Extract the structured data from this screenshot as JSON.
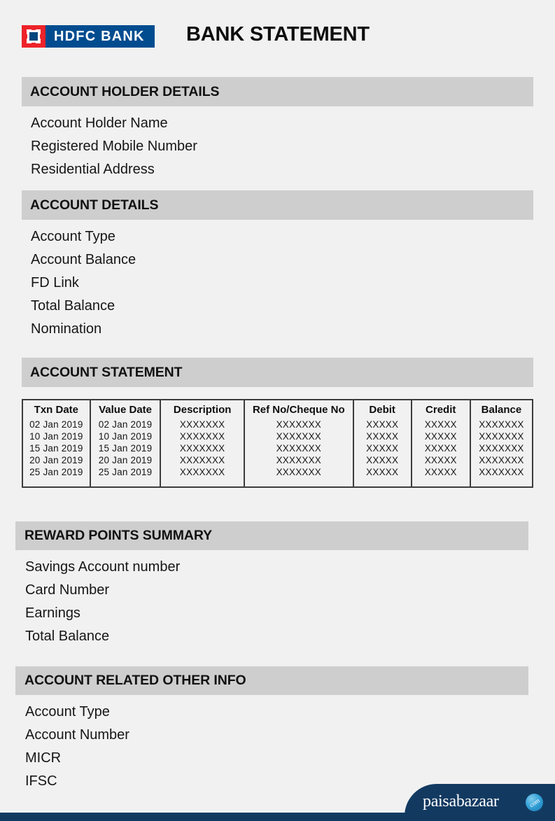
{
  "header": {
    "logo_text": "HDFC BANK",
    "title": "BANK STATEMENT",
    "logo_red": "#ed232a",
    "logo_blue": "#004c8f"
  },
  "sections": [
    {
      "title": "ACCOUNT HOLDER DETAILS",
      "lines": [
        "Account Holder Name",
        "Registered Mobile Number",
        "Residential Address"
      ]
    },
    {
      "title": "ACCOUNT DETAILS",
      "lines": [
        "Account Type",
        "Account Balance",
        "FD Link",
        "Total Balance",
        "Nomination"
      ]
    },
    {
      "title": "ACCOUNT STATEMENT",
      "lines": []
    },
    {
      "title": "REWARD POINTS SUMMARY",
      "lines": [
        "Savings Account number",
        "Card Number",
        "Earnings",
        "Total Balance"
      ]
    },
    {
      "title": "ACCOUNT RELATED OTHER INFO",
      "lines": [
        "Account Type",
        "Account Number",
        "MICR",
        "IFSC"
      ]
    }
  ],
  "statement_table": {
    "columns": [
      "Txn Date",
      "Value Date",
      "Description",
      "Ref No/Cheque No",
      "Debit",
      "Credit",
      "Balance"
    ],
    "rows": [
      [
        "02 Jan 2019",
        "02 Jan 2019",
        "XXXXXXX",
        "XXXXXXX",
        "XXXXX",
        "XXXXX",
        "XXXXXXX"
      ],
      [
        "10 Jan 2019",
        "10 Jan 2019",
        "XXXXXXX",
        "XXXXXXX",
        "XXXXX",
        "XXXXX",
        "XXXXXXX"
      ],
      [
        "15 Jan 2019",
        "15 Jan 2019",
        "XXXXXXX",
        "XXXXXXX",
        "XXXXX",
        "XXXXX",
        "XXXXXXX"
      ],
      [
        "20 Jan 2019",
        "20 Jan 2019",
        "XXXXXXX",
        "XXXXXXX",
        "XXXXX",
        "XXXXX",
        "XXXXXXX"
      ],
      [
        "25 Jan 2019",
        "25 Jan 2019",
        "XXXXXXX",
        "XXXXXXX",
        "XXXXX",
        "XXXXX",
        "XXXXXXX"
      ]
    ]
  },
  "footer": {
    "brand": "paisabazaar",
    "suffix": "com",
    "navy": "#123a61"
  }
}
